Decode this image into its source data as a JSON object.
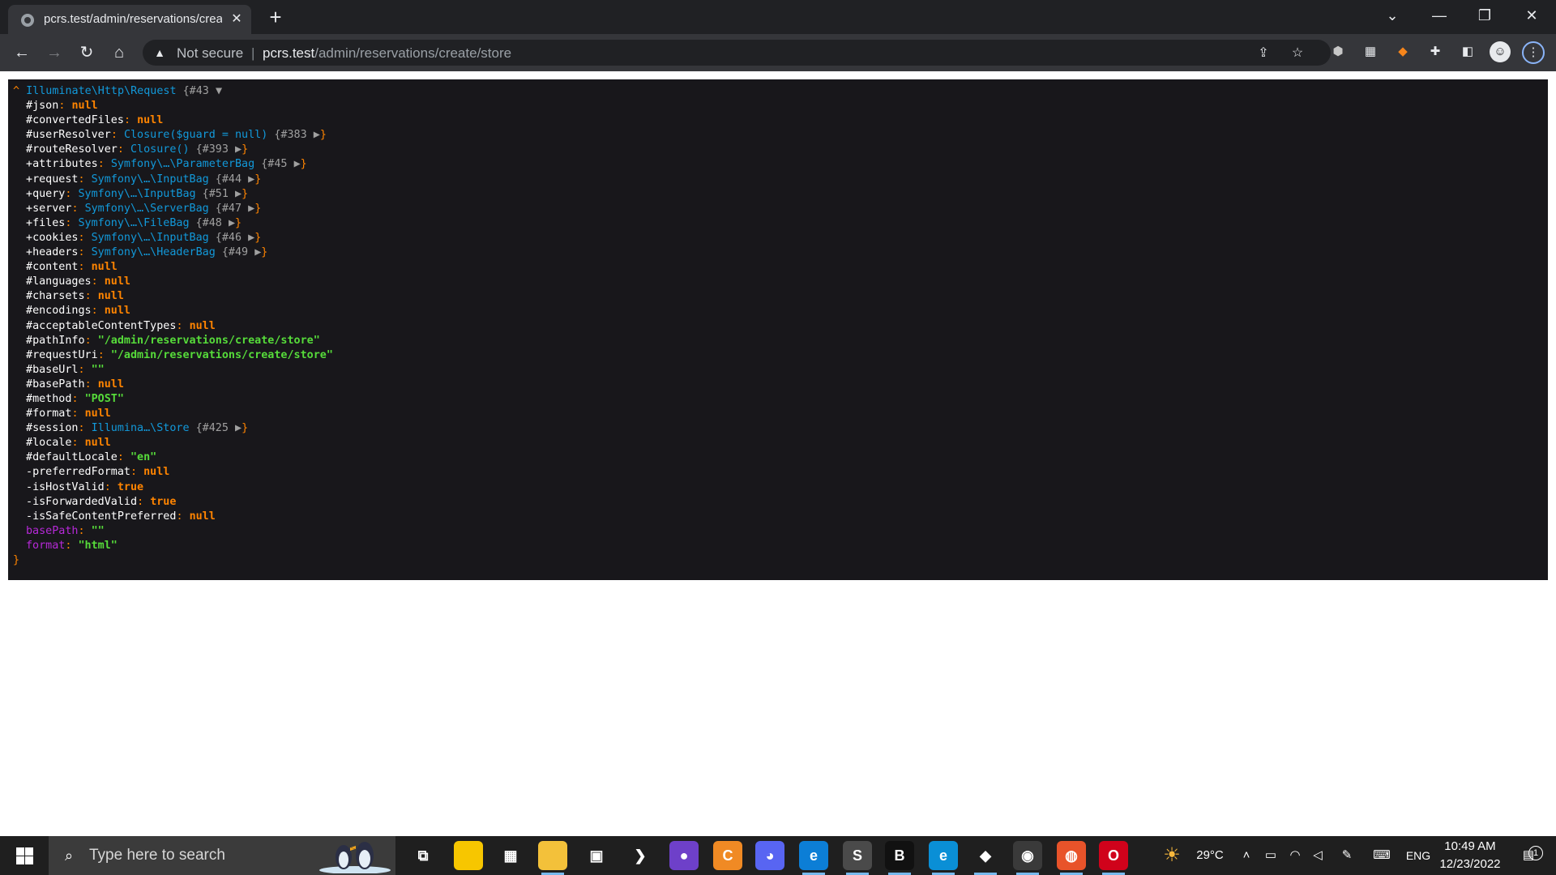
{
  "browser": {
    "tab_title": "pcrs.test/admin/reservations/create/store",
    "tab_close": "✕",
    "new_tab": "+",
    "window_controls": {
      "dropdown": "⌄",
      "minimize": "—",
      "restore": "❐",
      "close": "✕"
    },
    "nav": {
      "back": "←",
      "forward": "→",
      "reload": "↻",
      "home": "⌂"
    },
    "omnibox": {
      "warning_icon": "▲",
      "not_secure": "Not secure",
      "separator": "|",
      "url_host": "pcrs.test",
      "url_path": "/admin/reservations/create/store"
    },
    "icons": [
      "share-icon",
      "bookmark-star-icon",
      "extension-cube-icon",
      "qr-translate-icon",
      "metamask-fox-icon",
      "puzzle-extensions-icon",
      "side-panel-icon",
      "profile-avatar-icon",
      "menu-dots-icon"
    ]
  },
  "dump": {
    "header": {
      "caret": "^",
      "class": "Illuminate\\Http\\Request",
      "ref": "{#43",
      "toggle": "▼"
    },
    "lines": [
      {
        "vis": "#",
        "key": "json",
        "colon": ": ",
        "val": "null",
        "type": "null"
      },
      {
        "vis": "#",
        "key": "convertedFiles",
        "colon": ": ",
        "val": "null",
        "type": "null"
      },
      {
        "vis": "#",
        "key": "userResolver",
        "colon": ": ",
        "val": "Closure($guard = null)",
        "type": "cls",
        "ref": " {#383 ",
        "arrow": "▶",
        "close": "}"
      },
      {
        "vis": "#",
        "key": "routeResolver",
        "colon": ": ",
        "val": "Closure()",
        "type": "cls",
        "ref": " {#393 ",
        "arrow": "▶",
        "close": "}"
      },
      {
        "vis": "+",
        "key": "attributes",
        "colon": ": ",
        "val": "Symfony\\…\\ParameterBag",
        "type": "cls",
        "ref": " {#45 ",
        "arrow": "▶",
        "close": "}"
      },
      {
        "vis": "+",
        "key": "request",
        "colon": ": ",
        "val": "Symfony\\…\\InputBag",
        "type": "cls",
        "ref": " {#44 ",
        "arrow": "▶",
        "close": "}"
      },
      {
        "vis": "+",
        "key": "query",
        "colon": ": ",
        "val": "Symfony\\…\\InputBag",
        "type": "cls",
        "ref": " {#51 ",
        "arrow": "▶",
        "close": "}"
      },
      {
        "vis": "+",
        "key": "server",
        "colon": ": ",
        "val": "Symfony\\…\\ServerBag",
        "type": "cls",
        "ref": " {#47 ",
        "arrow": "▶",
        "close": "}"
      },
      {
        "vis": "+",
        "key": "files",
        "colon": ": ",
        "val": "Symfony\\…\\FileBag",
        "type": "cls",
        "ref": " {#48 ",
        "arrow": "▶",
        "close": "}"
      },
      {
        "vis": "+",
        "key": "cookies",
        "colon": ": ",
        "val": "Symfony\\…\\InputBag",
        "type": "cls",
        "ref": " {#46 ",
        "arrow": "▶",
        "close": "}"
      },
      {
        "vis": "+",
        "key": "headers",
        "colon": ": ",
        "val": "Symfony\\…\\HeaderBag",
        "type": "cls",
        "ref": " {#49 ",
        "arrow": "▶",
        "close": "}"
      },
      {
        "vis": "#",
        "key": "content",
        "colon": ": ",
        "val": "null",
        "type": "null"
      },
      {
        "vis": "#",
        "key": "languages",
        "colon": ": ",
        "val": "null",
        "type": "null"
      },
      {
        "vis": "#",
        "key": "charsets",
        "colon": ": ",
        "val": "null",
        "type": "null"
      },
      {
        "vis": "#",
        "key": "encodings",
        "colon": ": ",
        "val": "null",
        "type": "null"
      },
      {
        "vis": "#",
        "key": "acceptableContentTypes",
        "colon": ": ",
        "val": "null",
        "type": "null"
      },
      {
        "vis": "#",
        "key": "pathInfo",
        "colon": ": ",
        "val": "\"/admin/reservations/create/store\"",
        "type": "str"
      },
      {
        "vis": "#",
        "key": "requestUri",
        "colon": ": ",
        "val": "\"/admin/reservations/create/store\"",
        "type": "str"
      },
      {
        "vis": "#",
        "key": "baseUrl",
        "colon": ": ",
        "val": "\"\"",
        "type": "str"
      },
      {
        "vis": "#",
        "key": "basePath",
        "colon": ": ",
        "val": "null",
        "type": "null"
      },
      {
        "vis": "#",
        "key": "method",
        "colon": ": ",
        "val": "\"POST\"",
        "type": "str"
      },
      {
        "vis": "#",
        "key": "format",
        "colon": ": ",
        "val": "null",
        "type": "null"
      },
      {
        "vis": "#",
        "key": "session",
        "colon": ": ",
        "val": "Illumina…\\Store",
        "type": "cls",
        "ref": " {#425 ",
        "arrow": "▶",
        "close": "}"
      },
      {
        "vis": "#",
        "key": "locale",
        "colon": ": ",
        "val": "null",
        "type": "null"
      },
      {
        "vis": "#",
        "key": "defaultLocale",
        "colon": ": ",
        "val": "\"en\"",
        "type": "str"
      },
      {
        "vis": "-",
        "key": "preferredFormat",
        "colon": ": ",
        "val": "null",
        "type": "null"
      },
      {
        "vis": "-",
        "key": "isHostValid",
        "colon": ": ",
        "val": "true",
        "type": "bool"
      },
      {
        "vis": "-",
        "key": "isForwardedValid",
        "colon": ": ",
        "val": "true",
        "type": "bool"
      },
      {
        "vis": "-",
        "key": "isSafeContentPreferred",
        "colon": ": ",
        "val": "null",
        "type": "null"
      },
      {
        "vis": "",
        "key": "basePath",
        "colon": ": ",
        "val": "\"\"",
        "type": "str",
        "virtual": true
      },
      {
        "vis": "",
        "key": "format",
        "colon": ": ",
        "val": "\"html\"",
        "type": "str",
        "virtual": true
      }
    ],
    "footer": "}"
  },
  "taskbar": {
    "search_placeholder": "Type here to search",
    "apps": [
      {
        "name": "task-view-icon",
        "glyph": "⧉",
        "bg": "transparent"
      },
      {
        "name": "sticky-notes-icon",
        "glyph": "",
        "bg": "#f7c600"
      },
      {
        "name": "microsoft-store-icon",
        "glyph": "▦",
        "bg": "transparent"
      },
      {
        "name": "file-explorer-icon",
        "glyph": "",
        "bg": "#f3c13a"
      },
      {
        "name": "control-panel-icon",
        "glyph": "▣",
        "bg": "transparent"
      },
      {
        "name": "git-bash-icon",
        "glyph": "❯",
        "bg": "transparent"
      },
      {
        "name": "github-desktop-icon",
        "glyph": "●",
        "bg": "#6e40c9"
      },
      {
        "name": "ccleaner-icon",
        "glyph": "C",
        "bg": "#f08a24"
      },
      {
        "name": "discord-icon",
        "glyph": "◕",
        "bg": "#5865f2"
      },
      {
        "name": "edge-dev-icon",
        "glyph": "e",
        "bg": "#0c7ed6"
      },
      {
        "name": "sublime-text-icon",
        "glyph": "S",
        "bg": "#4a4a4a"
      },
      {
        "name": "brave-bitcoin-icon",
        "glyph": "B",
        "bg": "#111111"
      },
      {
        "name": "edge-icon",
        "glyph": "e",
        "bg": "#0a8fd6"
      },
      {
        "name": "git-icon",
        "glyph": "◆",
        "bg": "transparent"
      },
      {
        "name": "chrome-icon",
        "glyph": "◉",
        "bg": "#3a3a3a"
      },
      {
        "name": "firefox-icon",
        "glyph": "◍",
        "bg": "#e8532a"
      },
      {
        "name": "opera-icon",
        "glyph": "O",
        "bg": "#d0021b"
      }
    ],
    "weather_temp": "29°C",
    "language": "ENG",
    "time": "10:49 AM",
    "date": "12/23/2022",
    "notification_count": "1"
  }
}
